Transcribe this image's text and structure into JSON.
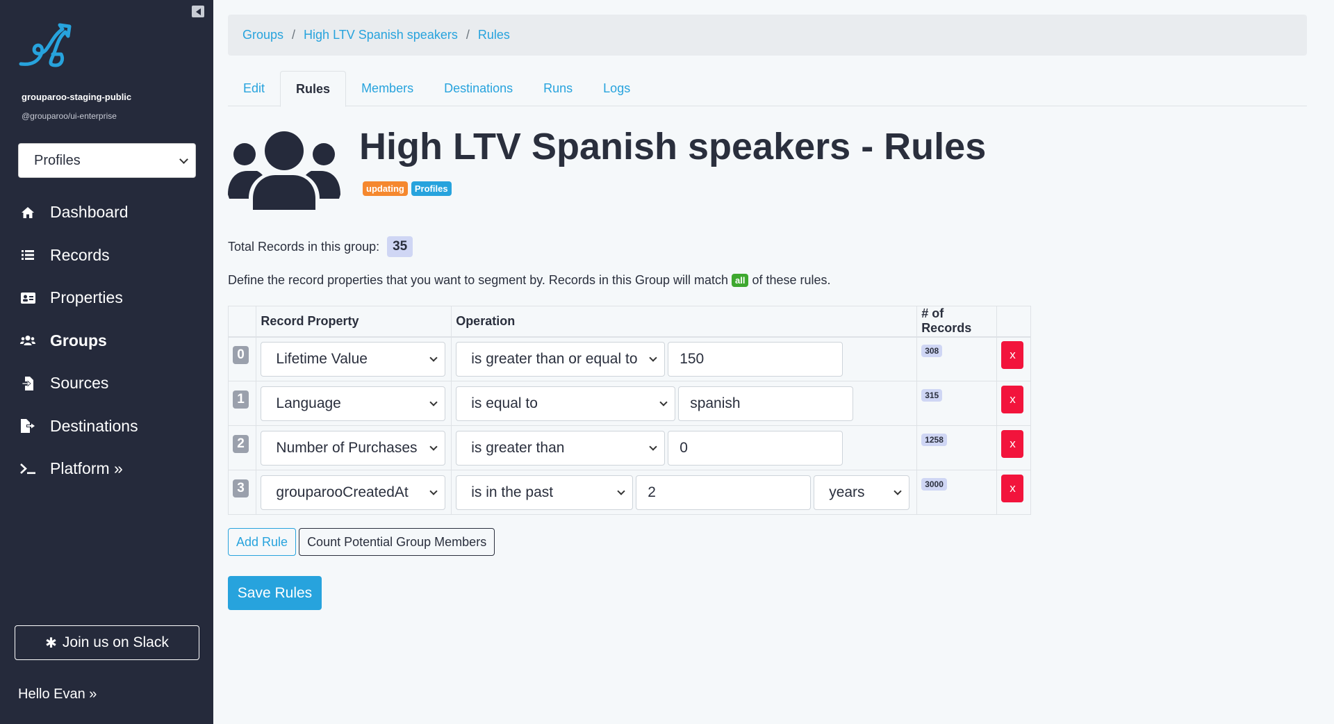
{
  "sidebar": {
    "org_name": "grouparoo-staging-public",
    "org_handle": "@grouparoo/ui-enterprise",
    "model_select": "Profiles",
    "nav": [
      {
        "label": "Dashboard",
        "icon": "home-icon"
      },
      {
        "label": "Records",
        "icon": "list-icon"
      },
      {
        "label": "Properties",
        "icon": "id-card-icon"
      },
      {
        "label": "Groups",
        "icon": "users-icon"
      },
      {
        "label": "Sources",
        "icon": "file-import-icon"
      },
      {
        "label": "Destinations",
        "icon": "file-export-icon"
      },
      {
        "label": "Platform »",
        "icon": "terminal-icon"
      }
    ],
    "slack_label": "Join us on Slack",
    "hello": "Hello Evan »"
  },
  "breadcrumb": [
    "Groups",
    "High LTV Spanish speakers",
    "Rules"
  ],
  "tabs": [
    "Edit",
    "Rules",
    "Members",
    "Destinations",
    "Runs",
    "Logs"
  ],
  "active_tab": "Rules",
  "page": {
    "title": "High LTV Spanish speakers - Rules",
    "badges": [
      {
        "label": "updating",
        "color": "#f5882e"
      },
      {
        "label": "Profiles",
        "color": "#27a3dd"
      }
    ],
    "total_label": "Total Records in this group:",
    "total_count": "35",
    "define_before": "Define the record properties that you want to segment by. Records in this Group will match",
    "define_match": "all",
    "define_after": "of these rules."
  },
  "table": {
    "headers": [
      "",
      "Record Property",
      "Operation",
      "# of Records",
      ""
    ],
    "rows": [
      {
        "index": "0",
        "property": "Lifetime Value",
        "operation": "is greater than or equal to",
        "value": "150",
        "unit": "",
        "count": "308",
        "delete": "x"
      },
      {
        "index": "1",
        "property": "Language",
        "operation": "is equal to",
        "value": "spanish",
        "unit": "",
        "count": "315",
        "delete": "x"
      },
      {
        "index": "2",
        "property": "Number of Purchases",
        "operation": "is greater than",
        "value": "0",
        "unit": "",
        "count": "1258",
        "delete": "x"
      },
      {
        "index": "3",
        "property": "grouparooCreatedAt",
        "operation": "is in the past",
        "value": "2",
        "unit": "years",
        "count": "3000",
        "delete": "x"
      }
    ]
  },
  "buttons": {
    "add_rule": "Add Rule",
    "count_members": "Count Potential Group Members",
    "save_rules": "Save Rules"
  },
  "colors": {
    "sidebar_bg": "#252a3b",
    "accent": "#27a3dd",
    "danger": "#f2143c",
    "success": "#3ea82f",
    "warning": "#f5882e"
  }
}
